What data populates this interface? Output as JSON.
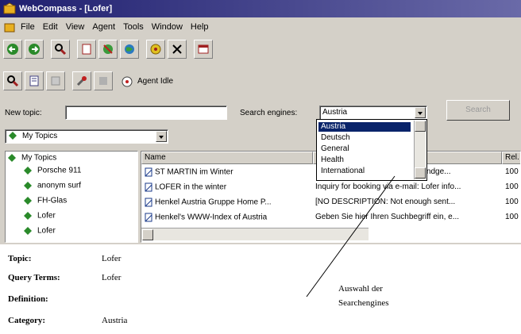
{
  "window": {
    "title": "WebCompass - [Lofer]"
  },
  "menu": [
    "File",
    "Edit",
    "View",
    "Agent",
    "Tools",
    "Window",
    "Help"
  ],
  "toolbar": {
    "status": "Agent Idle"
  },
  "search": {
    "new_topic_label": "New topic:",
    "new_topic_value": "",
    "engines_label": "Search engines:",
    "engine_selected": "Austria",
    "search_button": "Search",
    "options": [
      "Austria",
      "Deutsch",
      "General",
      "Health",
      "International"
    ]
  },
  "topics_combo": "My Topics",
  "tree": {
    "root": "My Topics",
    "items": [
      "Porsche 911",
      "anonym surf",
      "FH-Glas",
      "Lofer",
      "Lofer"
    ]
  },
  "results": {
    "columns": [
      "Name",
      "",
      "Rel."
    ],
    "rows": [
      {
        "name": "ST MARTIN im Winter",
        "desc": "und windge...",
        "rel": "100"
      },
      {
        "name": "LOFER in the winter",
        "desc": "Inquiry for booking via e-mail: Lofer info...",
        "rel": "100"
      },
      {
        "name": "Henkel Austria Gruppe Home P...",
        "desc": "[NO DESCRIPTION: Not enough sent...",
        "rel": "100"
      },
      {
        "name": "Henkel's WWW-Index of Austria",
        "desc": "Geben Sie hier Ihren Suchbegriff ein, e...",
        "rel": "100"
      }
    ]
  },
  "details": {
    "topic_label": "Topic:",
    "topic_value": "Lofer",
    "query_label": "Query Terms:",
    "query_value": "Lofer",
    "definition_label": "Definition:",
    "category_label": "Category:",
    "category_value": "Austria"
  },
  "annotation": {
    "line1": "Auswahl der",
    "line2": "Searchengines"
  }
}
